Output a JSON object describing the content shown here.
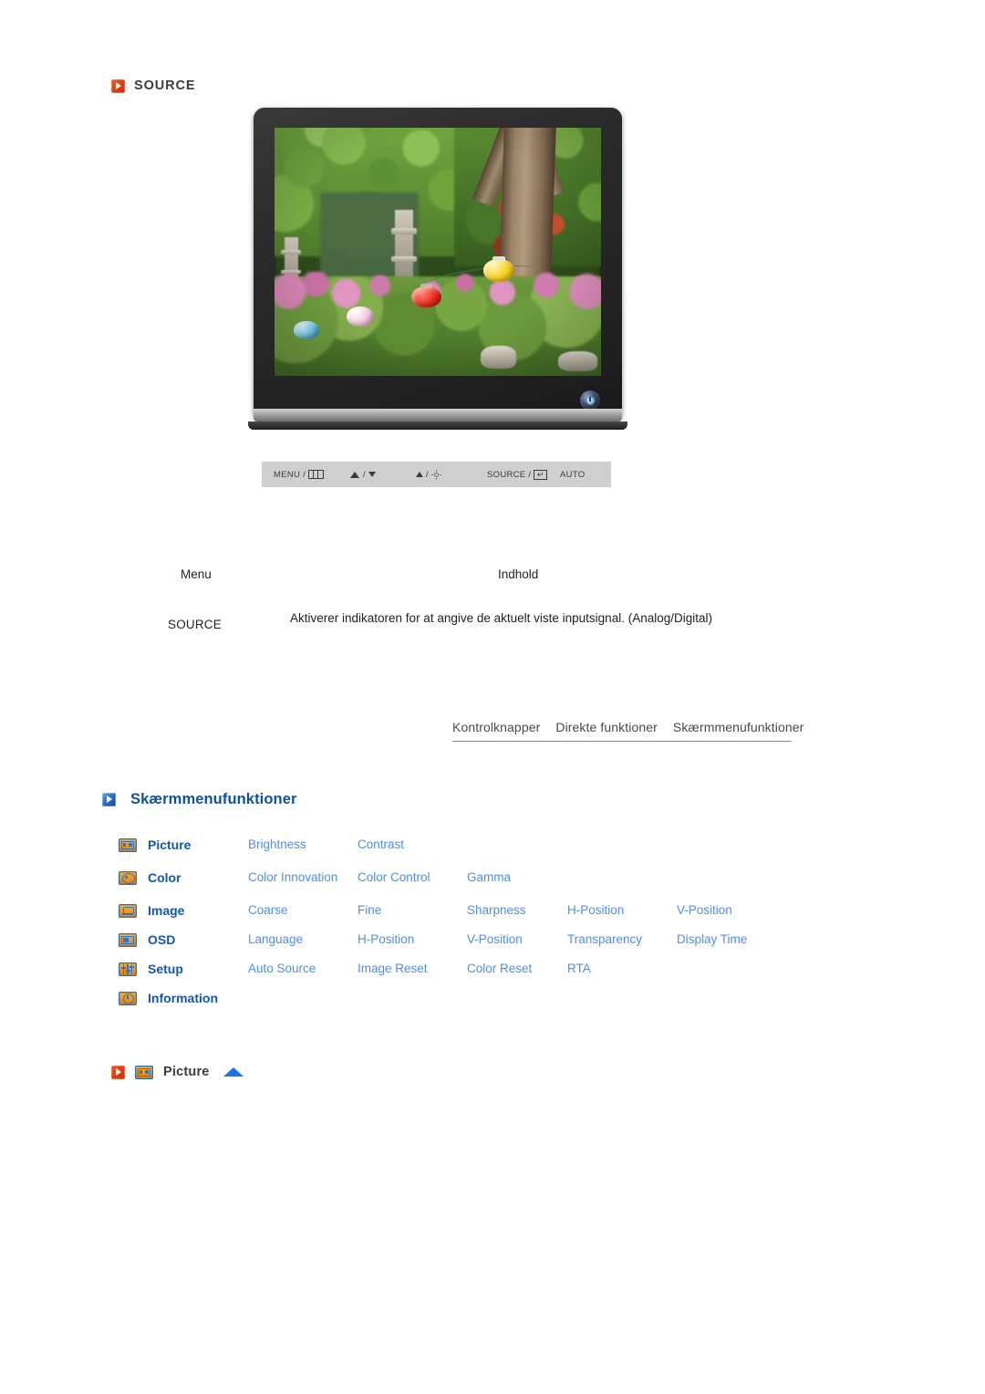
{
  "source_section": {
    "icon": "red-arrow-icon",
    "title": "SOURCE"
  },
  "monitor": {
    "alt": "lcd-monitor-showing-garden-photo",
    "power_button": "power-button",
    "control_keys": [
      {
        "label": "MENU /",
        "glyph": "menu-grid-icon"
      },
      {
        "label": "/",
        "glyph_left": "volume-icon",
        "glyph_right": "triangle-down-icon"
      },
      {
        "label": "/",
        "glyph_left": "triangle-up-icon",
        "glyph_right": "brightness-sun-icon"
      },
      {
        "label": "SOURCE /",
        "glyph": "enter-key-icon"
      },
      {
        "label": "AUTO",
        "glyph": "none"
      }
    ],
    "control_key_labels": {
      "menu": "MENU /",
      "slash": "/",
      "source": "SOURCE /",
      "auto": "AUTO"
    }
  },
  "description_table": {
    "header_menu": "Menu",
    "header_content": "Indhold",
    "row_label": "SOURCE",
    "row_text": "Aktiverer indikatoren for at angive de aktuelt viste inputsignal. (Analog/Digital)"
  },
  "tabs": [
    {
      "label": "Kontrolknapper"
    },
    {
      "label": "Direkte funktioner"
    },
    {
      "label": "Skærmmenufunktioner"
    }
  ],
  "osd_heading": {
    "icon": "blue-arrow-icon",
    "title": "Skærmmenufunktioner"
  },
  "osd_grid": {
    "rows": [
      {
        "icon": "picture-icon",
        "category": "Picture",
        "items": [
          "Brightness",
          "Contrast",
          "",
          "",
          ""
        ]
      },
      {
        "icon": "color-icon",
        "category": "Color",
        "items": [
          "Color Innovation",
          "Color Control",
          "Gamma",
          "",
          ""
        ]
      },
      {
        "icon": "image-icon",
        "category": "Image",
        "items": [
          "Coarse",
          "Fine",
          "Sharpness",
          "H-Position",
          "V-Position"
        ]
      },
      {
        "icon": "osd-icon",
        "category": "OSD",
        "items": [
          "Language",
          "H-Position",
          "V-Position",
          "Transparency",
          "Display Time"
        ]
      },
      {
        "icon": "setup-icon",
        "category": "Setup",
        "items": [
          "Auto Source",
          "Image Reset",
          "Color Reset",
          "RTA",
          ""
        ]
      },
      {
        "icon": "information-icon",
        "category": "Information",
        "items": [
          "",
          "",
          "",
          "",
          ""
        ]
      }
    ]
  },
  "picture_label": {
    "bullet_icon": "red-arrow-icon",
    "menu_icon": "picture-icon",
    "text": "Picture",
    "scroll_icon": "scroll-to-top-arrow"
  },
  "colors": {
    "accent_red": "#dd3c11",
    "accent_blue": "#12509e",
    "link_blue": "#4a8ef0",
    "category_blue": "#1556a8",
    "icon_orange": "#f0941f",
    "control_bar_bg": "#cfcfcf"
  }
}
